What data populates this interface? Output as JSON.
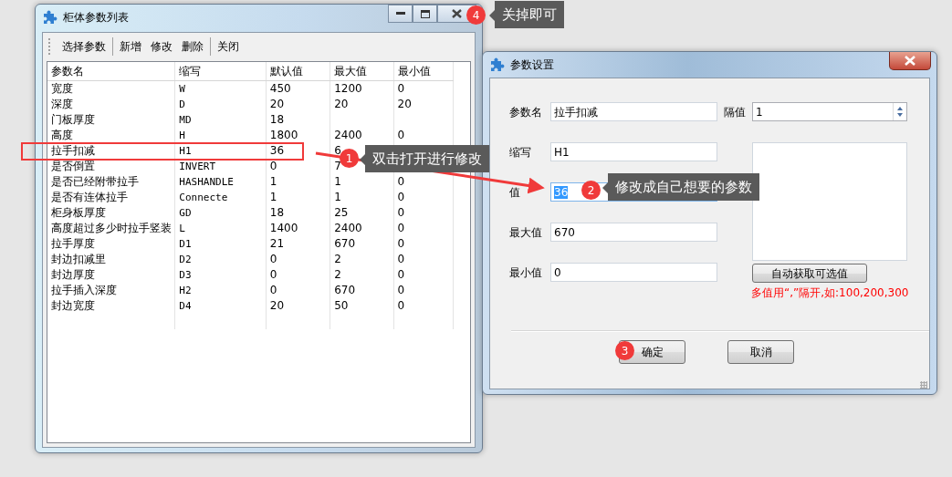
{
  "main_window": {
    "title": "柜体参数列表",
    "toolbar_groups": [
      [
        "选择参数"
      ],
      [
        "新增",
        "修改",
        "删除"
      ],
      [
        "关闭"
      ]
    ],
    "columns": [
      "参数名",
      "缩写",
      "默认值",
      "最大值",
      "最小值"
    ],
    "rows": [
      [
        "宽度",
        "W",
        "450",
        "1200",
        "0"
      ],
      [
        "深度",
        "D",
        "20",
        "20",
        "20"
      ],
      [
        "门板厚度",
        "MD",
        "18"
      ],
      [
        "高度",
        "H",
        "1800",
        "2400",
        "0"
      ],
      [
        "拉手扣减",
        "H1",
        "36",
        "6"
      ],
      [
        "是否倒置",
        "INVERT",
        "0",
        "7"
      ],
      [
        "是否已经附带拉手",
        "HASHANDLE",
        "1",
        "1",
        "0"
      ],
      [
        "是否有连体拉手",
        "Connecte",
        "1",
        "1",
        "0"
      ],
      [
        "柜身板厚度",
        "GD",
        "18",
        "25",
        "0"
      ],
      [
        "高度超过多少时拉手竖装",
        "L",
        "1400",
        "2400",
        "0"
      ],
      [
        "拉手厚度",
        "D1",
        "21",
        "670",
        "0"
      ],
      [
        "封边扣减里",
        "D2",
        "0",
        "2",
        "0"
      ],
      [
        "封边厚度",
        "D3",
        "0",
        "2",
        "0"
      ],
      [
        "拉手插入深度",
        "H2",
        "0",
        "670",
        "0"
      ],
      [
        "封边宽度",
        "D4",
        "20",
        "50",
        "0"
      ]
    ]
  },
  "dialog": {
    "title": "参数设置",
    "fields": [
      {
        "label": "参数名",
        "value": "拉手扣减",
        "text_selected": false
      },
      {
        "label": "缩写",
        "value": "H1",
        "text_selected": false
      },
      {
        "label": "值",
        "value": "36",
        "text_selected": true
      },
      {
        "label": "最大值",
        "value": "670",
        "text_selected": false
      },
      {
        "label": "最小值",
        "value": "0",
        "text_selected": false
      }
    ],
    "interval": {
      "label": "隔值",
      "value": "1"
    },
    "auto_button": "自动获取可选值",
    "hint": "多值用“,”隔开,如:100,200,300",
    "buttons": [
      "确定",
      "取消"
    ]
  },
  "annotations": [
    {
      "number": "1",
      "text": "双击打开进行修改"
    },
    {
      "number": "2",
      "text": "修改成自己想要的参数"
    },
    {
      "number": "3"
    },
    {
      "number": "4",
      "text": "关掉即可"
    }
  ]
}
